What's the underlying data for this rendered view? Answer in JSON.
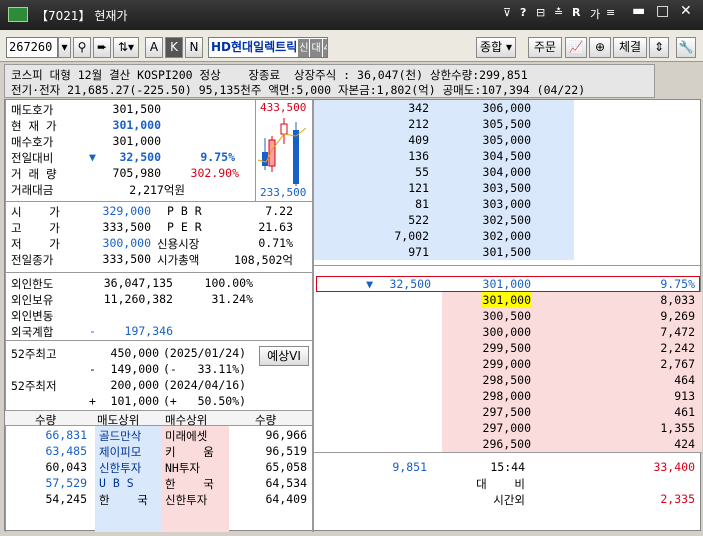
{
  "window": {
    "code_title": "【7021】",
    "title": "현재가"
  },
  "titlebar_icons": [
    "pin-icon",
    "help-icon",
    "link-icon",
    "lock-icon",
    "r-icon",
    "font-icon",
    "menu-icon",
    "minimize-icon",
    "maximize-icon",
    "close-icon"
  ],
  "toolbar": {
    "code": "267260",
    "name": "HD현대일렉트릭",
    "chip1": "신",
    "chip2": "대",
    "chip3": "40",
    "btn_a": "A",
    "btn_k": "K",
    "btn_n": "N",
    "jonghap": "종합",
    "jumun": "주문",
    "chegyeol": "체결"
  },
  "info": {
    "row1": "코스피 대형 12월 결산 KOSPI200 정상    장종료  상장주식 : 36,047(천) 상한수량:299,851",
    "row2": "전기·전자 21,685.27(-225.50) 95,135천주 액면:5,000 자본금:1,802(억) 공매도:107,394 (04/22)"
  },
  "quote": {
    "ask_label": "매도호가",
    "ask": "301,500",
    "cur_label": "현 재 가",
    "cur": "301,000",
    "bid_label": "매수호가",
    "bid": "301,000",
    "chg_label": "전일대비",
    "chg_arrow": "▼",
    "chg": "32,500",
    "chg_pct": "9.75%",
    "vol_label": "거 래 량",
    "vol": "705,980",
    "vol_ratio": "302.90%",
    "amt_label": "거래대금",
    "amt": "2,217억원"
  },
  "minichart": {
    "high": "433,500",
    "low": "233,500"
  },
  "price": {
    "open_label": "시    가",
    "open": "329,000",
    "per_label1": "P B R",
    "pbr": "7.22",
    "high_label": "고    가",
    "high": "333,500",
    "per_label2": "P E R",
    "per": "21.63",
    "low_label": "저    가",
    "low": "300,000",
    "credit_label": "신용시장",
    "credit": "0.71%",
    "prev_label": "전일종가",
    "prev": "333,500",
    "mcap_label": "시가총액",
    "mcap": "108,502억"
  },
  "foreign": {
    "limit_label": "외인한도",
    "limit": "36,047,135",
    "limit_pct": "100.00%",
    "hold_label": "외인보유",
    "hold": "11,260,382",
    "hold_pct": "31.24%",
    "chg_label": "외인변동",
    "sum_label": "외국계합",
    "sum_sign": "-",
    "sum": "197,346"
  },
  "week52": {
    "high_label": "52주최고",
    "high": "450,000",
    "high_date": "(2025/01/24)",
    "high_diff_sign": "-",
    "high_diff": "149,000",
    "high_pct": "(-   33.11%)",
    "low_label": "52주최저",
    "low": "200,000",
    "low_date": "(2024/04/16)",
    "low_diff_sign": "+",
    "low_diff": "101,000",
    "low_pct": "(+   50.50%)",
    "forecast_btn": "예상VI"
  },
  "brokers": {
    "h_qty1": "수량",
    "h_sell": "매도상위",
    "h_buy": "매수상위",
    "h_qty2": "수량",
    "rows": [
      {
        "sq": "66,831",
        "sn": "골드만삭",
        "bn": "미래에셋",
        "bq": "96,966"
      },
      {
        "sq": "63,485",
        "sn": "제이피모",
        "bn": "키    움",
        "bq": "96,519"
      },
      {
        "sq": "60,043",
        "sn": "신한투자",
        "bn": "NH투자",
        "bq": "65,058"
      },
      {
        "sq": "57,529",
        "sn": "U B S",
        "bn": "한    국",
        "bq": "64,534"
      },
      {
        "sq": "54,245",
        "sn": "한    국",
        "bn": "신한투자",
        "bq": "64,409"
      }
    ]
  },
  "orderbook": {
    "asks": [
      {
        "q": "342",
        "p": "306,000"
      },
      {
        "q": "212",
        "p": "305,500"
      },
      {
        "q": "409",
        "p": "305,000"
      },
      {
        "q": "136",
        "p": "304,500"
      },
      {
        "q": "55",
        "p": "304,000"
      },
      {
        "q": "121",
        "p": "303,500"
      },
      {
        "q": "81",
        "p": "303,000"
      },
      {
        "q": "522",
        "p": "302,500"
      },
      {
        "q": "7,002",
        "p": "302,000"
      },
      {
        "q": "971",
        "p": "301,500"
      }
    ],
    "mid_arrow": "▼",
    "mid_chg": "32,500",
    "mid_price": "301,000",
    "mid_pct": "9.75%",
    "bids": [
      {
        "p": "301,000",
        "q": "8,033"
      },
      {
        "p": "300,500",
        "q": "9,269"
      },
      {
        "p": "300,000",
        "q": "7,472"
      },
      {
        "p": "299,500",
        "q": "2,242"
      },
      {
        "p": "299,000",
        "q": "2,767"
      },
      {
        "p": "298,500",
        "q": "464"
      },
      {
        "p": "298,000",
        "q": "913"
      },
      {
        "p": "297,500",
        "q": "461"
      },
      {
        "p": "297,000",
        "q": "1,355"
      },
      {
        "p": "296,500",
        "q": "424"
      }
    ],
    "total_ask": "9,851",
    "time": "15:44",
    "total_bid": "33,400",
    "diff_label": "대    비",
    "after_label": "시간외",
    "after_bid": "2,335"
  }
}
